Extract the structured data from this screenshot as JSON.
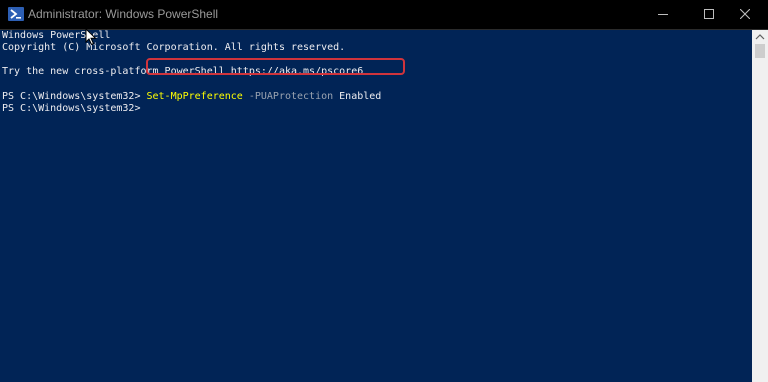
{
  "window": {
    "title": "Administrator: Windows PowerShell"
  },
  "console": {
    "lines": [
      "Windows PowerShell",
      "Copyright (C) Microsoft Corporation. All rights reserved.",
      "",
      "Try the new cross-platform PowerShell https://aka.ms/pscore6",
      ""
    ],
    "command_line": {
      "prompt": "PS C:\\Windows\\system32> ",
      "cmdlet": "Set-MpPreference",
      "parameter": " -PUAProtection",
      "value": " Enabled"
    },
    "current_prompt": "PS C:\\Windows\\system32>"
  },
  "colors": {
    "background": "#012456",
    "highlight_border": "#d0343c",
    "cmdlet": "#ffff00"
  },
  "icons": {
    "app": "powershell-icon",
    "minimize": "minimize-icon",
    "maximize": "maximize-icon",
    "close": "close-icon",
    "cursor": "mouse-pointer-icon"
  }
}
